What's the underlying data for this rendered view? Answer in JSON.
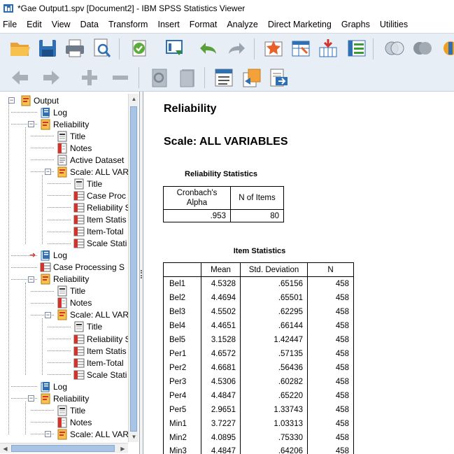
{
  "window": {
    "title": "*Gae Output1.spv [Document2] - IBM SPSS Statistics Viewer"
  },
  "menu": [
    "File",
    "Edit",
    "View",
    "Data",
    "Transform",
    "Insert",
    "Format",
    "Analyze",
    "Direct Marketing",
    "Graphs",
    "Utilities"
  ],
  "toolbar1": [
    "open-icon",
    "save-icon",
    "print-icon",
    "print-preview-icon",
    "export-icon",
    "recall-dialog-icon",
    "undo-icon",
    "redo-icon",
    "goto-data-icon",
    "goto-case-icon",
    "goto-variable-icon",
    "variables-icon",
    "select-cases-icon",
    "weight-cases-icon",
    "value-labels-icon"
  ],
  "toolbar2": [
    "promote-icon",
    "demote-icon",
    "expand-icon",
    "collapse-icon",
    "show-icon",
    "hide-icon",
    "insert-heading-icon",
    "insert-title-icon",
    "insert-text-icon"
  ],
  "tree": {
    "nodes": [
      {
        "label": "Output",
        "icon": "book-icon",
        "level": 0
      },
      {
        "label": "Log",
        "icon": "log-icon",
        "level": 1
      },
      {
        "label": "Reliability",
        "icon": "book-icon",
        "level": 1
      },
      {
        "label": "Title",
        "icon": "title-icon",
        "level": 2
      },
      {
        "label": "Notes",
        "icon": "notes-icon",
        "level": 2
      },
      {
        "label": "Active Dataset",
        "icon": "text-icon",
        "level": 2
      },
      {
        "label": "Scale: ALL VAR",
        "icon": "book-icon",
        "level": 2
      },
      {
        "label": "Title",
        "icon": "title-icon",
        "level": 3
      },
      {
        "label": "Case Proc",
        "icon": "table-icon",
        "level": 3
      },
      {
        "label": "Reliability S",
        "icon": "table-icon",
        "level": 3
      },
      {
        "label": "Item Statis",
        "icon": "table-icon",
        "level": 3
      },
      {
        "label": "Item-Total",
        "icon": "table-icon",
        "level": 3
      },
      {
        "label": "Scale Stati",
        "icon": "table-icon",
        "level": 3
      },
      {
        "label": "Log",
        "icon": "log-icon",
        "level": 1
      },
      {
        "label": "Case Processing S",
        "icon": "table-icon",
        "level": 1
      },
      {
        "label": "Reliability",
        "icon": "book-icon",
        "level": 1
      },
      {
        "label": "Title",
        "icon": "title-icon",
        "level": 2
      },
      {
        "label": "Notes",
        "icon": "notes-icon",
        "level": 2
      },
      {
        "label": "Scale: ALL VAR",
        "icon": "book-icon",
        "level": 2
      },
      {
        "label": "Title",
        "icon": "title-icon",
        "level": 3
      },
      {
        "label": "Reliability S",
        "icon": "table-icon",
        "level": 3
      },
      {
        "label": "Item Statis",
        "icon": "table-icon",
        "level": 3
      },
      {
        "label": "Item-Total",
        "icon": "table-icon",
        "level": 3
      },
      {
        "label": "Scale Stati",
        "icon": "table-icon",
        "level": 3
      },
      {
        "label": "Log",
        "icon": "log-icon",
        "level": 1
      },
      {
        "label": "Reliability",
        "icon": "book-icon",
        "level": 1
      },
      {
        "label": "Title",
        "icon": "title-icon",
        "level": 2
      },
      {
        "label": "Notes",
        "icon": "notes-icon",
        "level": 2
      },
      {
        "label": "Scale: ALL VAR",
        "icon": "book-icon",
        "level": 2
      }
    ],
    "current_item_index": 13
  },
  "content": {
    "heading": "Reliability",
    "scale_heading": "Scale: ALL VARIABLES",
    "reliability_statistics": {
      "caption": "Reliability Statistics",
      "columns": [
        "Cronbach's Alpha",
        "N of Items"
      ],
      "row": [
        ".953",
        "80"
      ]
    },
    "item_statistics": {
      "caption": "Item Statistics",
      "columns": [
        "",
        "Mean",
        "Std. Deviation",
        "N"
      ],
      "rows": [
        [
          "Bel1",
          "4.5328",
          ".65156",
          "458"
        ],
        [
          "Bel2",
          "4.4694",
          ".65501",
          "458"
        ],
        [
          "Bel3",
          "4.5502",
          ".62295",
          "458"
        ],
        [
          "Bel4",
          "4.4651",
          ".66144",
          "458"
        ],
        [
          "Bel5",
          "3.1528",
          "1.42447",
          "458"
        ],
        [
          "Per1",
          "4.6572",
          ".57135",
          "458"
        ],
        [
          "Per2",
          "4.6681",
          ".56436",
          "458"
        ],
        [
          "Per3",
          "4.5306",
          ".60282",
          "458"
        ],
        [
          "Per4",
          "4.4847",
          ".65220",
          "458"
        ],
        [
          "Per5",
          "2.9651",
          "1.33743",
          "458"
        ],
        [
          "Min1",
          "3.7227",
          "1.03313",
          "458"
        ],
        [
          "Min2",
          "4.0895",
          ".75330",
          "458"
        ],
        [
          "Min3",
          "4.4847",
          ".64206",
          "458"
        ]
      ]
    }
  }
}
